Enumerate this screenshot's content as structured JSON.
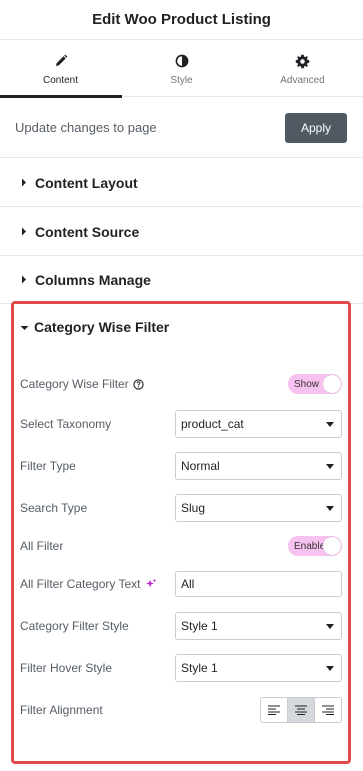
{
  "header": {
    "title": "Edit Woo Product Listing"
  },
  "tabs": [
    {
      "label": "Content",
      "icon": "pencil-icon"
    },
    {
      "label": "Style",
      "icon": "half-circle-icon"
    },
    {
      "label": "Advanced",
      "icon": "gear-icon"
    }
  ],
  "update": {
    "text": "Update changes to page",
    "button_label": "Apply"
  },
  "sections": [
    {
      "label": "Content Layout"
    },
    {
      "label": "Content Source"
    },
    {
      "label": "Columns Manage"
    }
  ],
  "category_filter": {
    "title": "Category Wise Filter",
    "category_wise_filter": {
      "label": "Category Wise Filter",
      "toggle": "Show"
    },
    "select_taxonomy": {
      "label": "Select Taxonomy",
      "value": "product_cat"
    },
    "filter_type": {
      "label": "Filter Type",
      "value": "Normal"
    },
    "search_type": {
      "label": "Search Type",
      "value": "Slug"
    },
    "all_filter": {
      "label": "All Filter",
      "toggle": "Enable"
    },
    "all_filter_text": {
      "label": "All Filter Category Text",
      "value": "All"
    },
    "category_filter_style": {
      "label": "Category Filter Style",
      "value": "Style 1"
    },
    "filter_hover_style": {
      "label": "Filter Hover Style",
      "value": "Style 1"
    },
    "filter_alignment": {
      "label": "Filter Alignment",
      "selected": "center"
    }
  },
  "colors": {
    "accent_toggle": "#f7c2f0",
    "highlight_border": "#e04a4a",
    "apply_button": "#515962"
  }
}
